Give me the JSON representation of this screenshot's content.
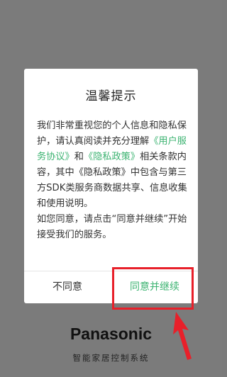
{
  "dialog": {
    "title": "温馨提示",
    "paragraph1": {
      "text_before_link1": "我们非常重视您的个人信息和隐私保护，请认真阅读并充分理解",
      "link_user_agreement": "《用户服务协议》",
      "text_between": "和",
      "link_privacy_policy": "《隐私政策》",
      "text_after": "相关条款内容，其中《隐私政策》中包含与第三方SDK类服务商数据共享、信息收集和使用说明。"
    },
    "paragraph2": "如您同意，请点击“同意并继续”开始接受我们的服务。",
    "buttons": {
      "disagree_label": "不同意",
      "agree_label": "同意并继续"
    }
  },
  "brand": {
    "logo_text": "Panasonic",
    "subtitle": "智能家居控制系统"
  },
  "colors": {
    "link": "#3cb371",
    "highlight": "#e8202a",
    "overlay": "#7b7b7b"
  }
}
